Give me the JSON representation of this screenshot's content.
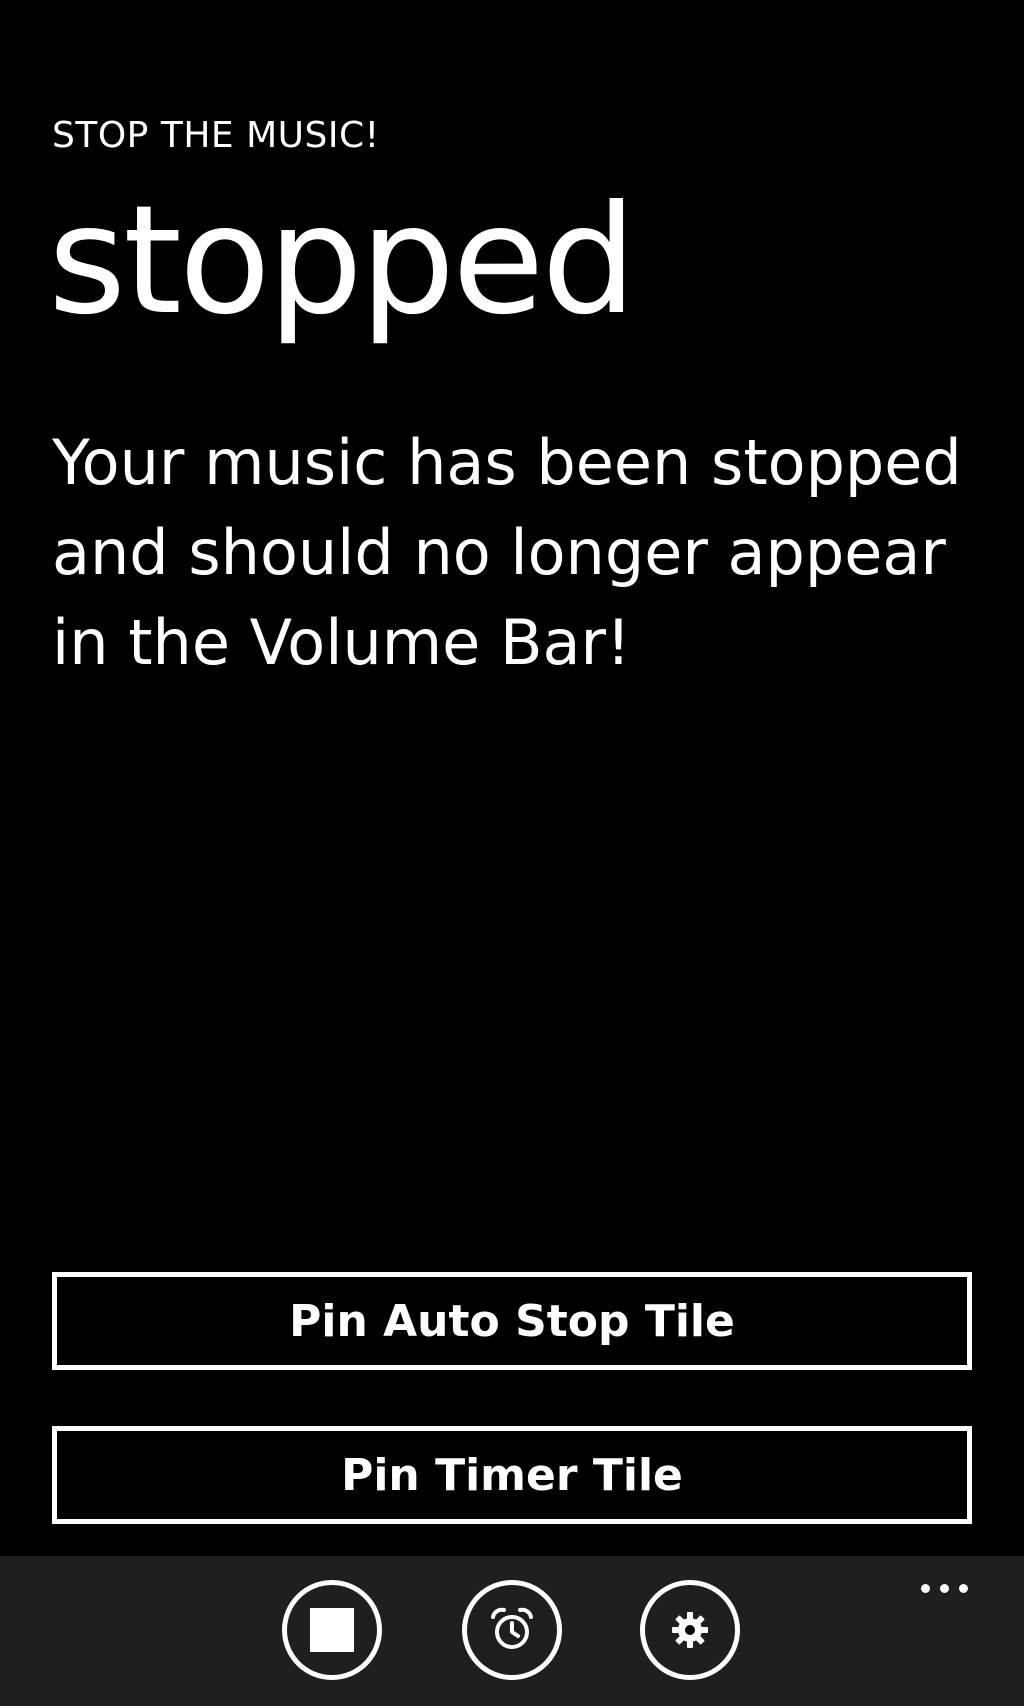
{
  "app": {
    "title": "STOP THE MUSIC!"
  },
  "page": {
    "title": "stopped",
    "message": "Your music has been stopped and should no longer appear in the Volume Bar!"
  },
  "buttons": {
    "pin_auto_stop": "Pin Auto Stop Tile",
    "pin_timer": "Pin Timer Tile"
  },
  "app_bar": {
    "icons": [
      "stop-icon",
      "alarm-clock-icon",
      "gear-icon",
      "more-ellipsis-icon"
    ]
  },
  "colors": {
    "background": "#000000",
    "foreground": "#ffffff",
    "app_bar": "#1f1f1f"
  }
}
